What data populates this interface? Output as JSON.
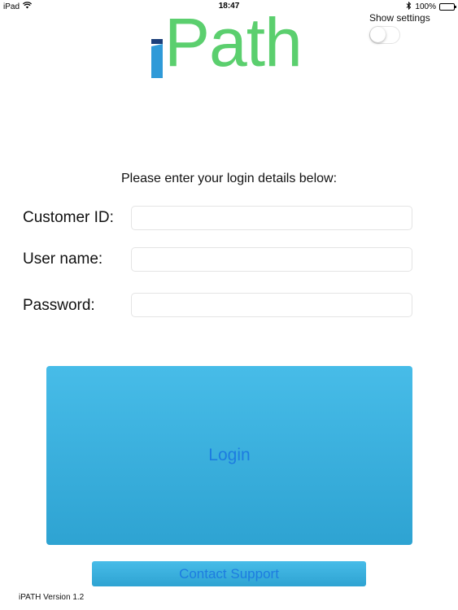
{
  "status_bar": {
    "device": "iPad",
    "time": "18:47",
    "battery_percent": "100%",
    "icons": [
      "wifi-icon",
      "bluetooth-icon",
      "battery-icon"
    ]
  },
  "logo": {
    "text": "Path",
    "color": "#5bcf6e",
    "mark_colors": [
      "#1b3f7a",
      "#2f9ad8"
    ]
  },
  "settings": {
    "label": "Show settings",
    "enabled": false
  },
  "form": {
    "instructions": "Please enter your login details below:",
    "fields": [
      {
        "label": "Customer ID:",
        "value": "",
        "placeholder": ""
      },
      {
        "label": "User name:",
        "value": "",
        "placeholder": ""
      },
      {
        "label": "Password:",
        "value": "",
        "placeholder": ""
      }
    ]
  },
  "buttons": {
    "login": "Login",
    "contact_support": "Contact Support",
    "text_color": "#1d7ce0",
    "background": "#3db2e0"
  },
  "footer": {
    "version": "iPATH Version 1.2"
  }
}
